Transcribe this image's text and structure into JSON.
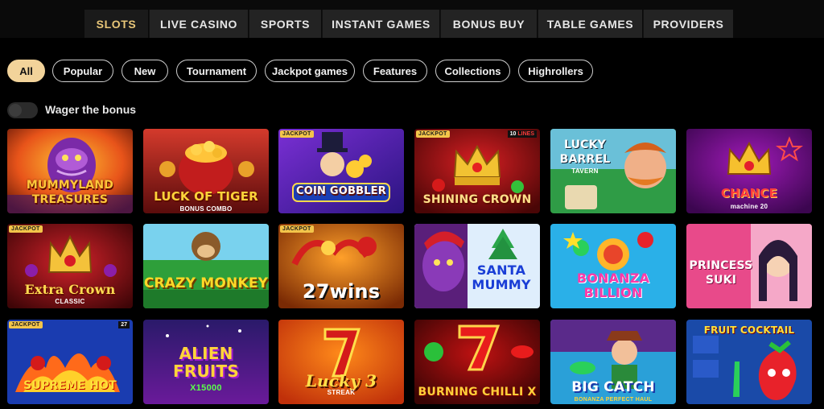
{
  "nav": {
    "tabs": [
      {
        "label": "SLOTS",
        "active": true
      },
      {
        "label": "LIVE CASINO"
      },
      {
        "label": "SPORTS"
      },
      {
        "label": "INSTANT GAMES"
      },
      {
        "label": "BONUS BUY"
      },
      {
        "label": "TABLE GAMES"
      },
      {
        "label": "PROVIDERS"
      }
    ]
  },
  "filters": {
    "items": [
      "All",
      "Popular",
      "New",
      "Tournament",
      "Jackpot games",
      "Features",
      "Collections",
      "Highrollers"
    ],
    "active": "All"
  },
  "wager_toggle": {
    "label": "Wager the bonus",
    "on": false
  },
  "badges": {
    "jackpot": "JACKPOT"
  },
  "games": [
    {
      "title": "MUMMYLAND TREASURES",
      "subtitle": "",
      "jackpot": false
    },
    {
      "title": "LUCK OF TIGER",
      "subtitle": "BONUS COMBO",
      "jackpot": false
    },
    {
      "title": "COIN GOBBLER",
      "subtitle": "",
      "jackpot": true
    },
    {
      "title": "SHINING CROWN",
      "subtitle": "",
      "jackpot": true,
      "lines": "10",
      "lines_suffix": "LINES"
    },
    {
      "title": "LUCKY BARREL",
      "subtitle": "TAVERN",
      "jackpot": false
    },
    {
      "title": "CHANCE",
      "subtitle": "machine 20",
      "jackpot": false
    },
    {
      "title": "Extra Crown",
      "subtitle": "CLASSIC",
      "jackpot": true
    },
    {
      "title": "CRAZY MONKEY",
      "subtitle": "",
      "jackpot": false
    },
    {
      "title": "27wins",
      "subtitle": "",
      "jackpot": true
    },
    {
      "title": "SANTA MUMMY",
      "subtitle": "",
      "jackpot": false
    },
    {
      "title": "BONANZA BILLION",
      "subtitle": "",
      "jackpot": false
    },
    {
      "title": "PRINCESS SUKI",
      "subtitle": "",
      "jackpot": false
    },
    {
      "title": "SUPREME HOT",
      "subtitle": "",
      "jackpot": true,
      "lines": "27",
      "lines_suffix": ""
    },
    {
      "title": "ALIEN FRUITS",
      "subtitle": "X15000",
      "jackpot": false
    },
    {
      "title": "Lucky 3",
      "subtitle": "STREAK",
      "jackpot": false
    },
    {
      "title": "BURNING CHILLI X",
      "subtitle": "",
      "jackpot": false
    },
    {
      "title": "BIG CATCH",
      "subtitle": "BONANZA PERFECT HAUL",
      "jackpot": false
    },
    {
      "title": "FRUIT COCKTAIL",
      "subtitle": "",
      "jackpot": false
    }
  ],
  "colors": {
    "accent": "#e8c678",
    "pill_active": "#f2d39a",
    "jackpot_badge": "#f3c54a",
    "nav_bg": "#232323"
  }
}
